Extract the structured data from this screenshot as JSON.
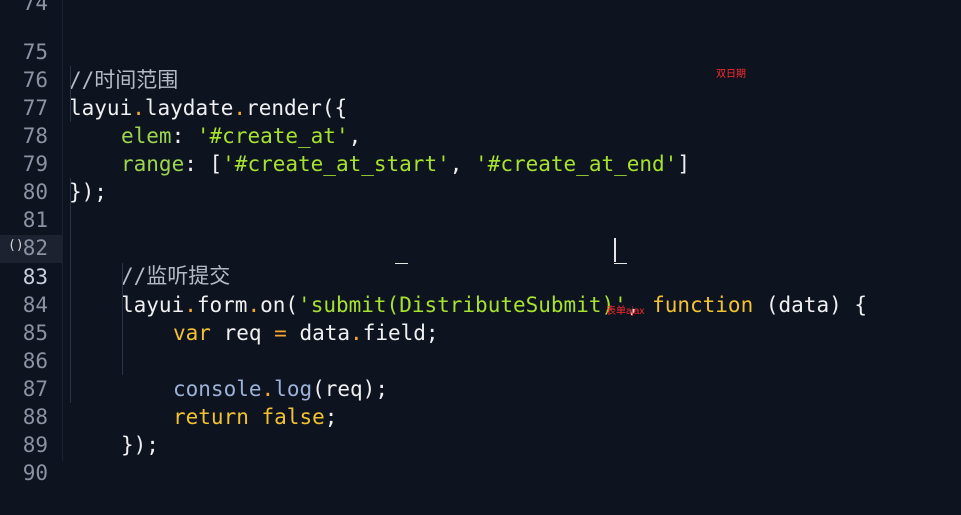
{
  "gutter": {
    "numbers": [
      "74",
      "75",
      "76",
      "77",
      "78",
      "79",
      "80",
      "81",
      "82",
      "83",
      "84",
      "85",
      "86",
      "87",
      "88",
      "89",
      "90"
    ],
    "current_line": "83",
    "fold_marker": "()"
  },
  "code": {
    "l75": "//时间范围",
    "l76a": "layui",
    "l76b": ".",
    "l76c": "laydate",
    "l76d": ".",
    "l76e": "render({",
    "l77a": "elem",
    "l77b": ": ",
    "l77c": "'#create_at'",
    "l77d": ",",
    "l78a": "range",
    "l78b": ": [",
    "l78c": "'#create_at_start'",
    "l78d": ", ",
    "l78e": "'#create_at_end'",
    "l78f": "]",
    "l79": "});",
    "l82": "//监听提交",
    "l83a": "layui",
    "l83b": ".",
    "l83c": "form",
    "l83d": ".",
    "l83e": "on(",
    "l83f": "'submit(DistributeSubmit)'",
    "l83g": ", ",
    "l83h": "function",
    "l83i": " (data) {",
    "l84a": "var",
    "l84b": " req ",
    "l84c": "=",
    "l84d": " data",
    "l84e": ".",
    "l84f": "field;",
    "l86a": "console",
    "l86b": ".",
    "l86c": "log",
    "l86d": "(req);",
    "l87a": "return",
    "l87b": " ",
    "l87c": "false",
    "l87d": ";",
    "l88": "});"
  },
  "annotations": {
    "date_note": "双日期",
    "form_note": "表单ajax"
  },
  "colors": {
    "background": "#0e1320",
    "keyword": "#f2c230",
    "string": "#a6e22e",
    "annotation": "#ff2a2a"
  }
}
